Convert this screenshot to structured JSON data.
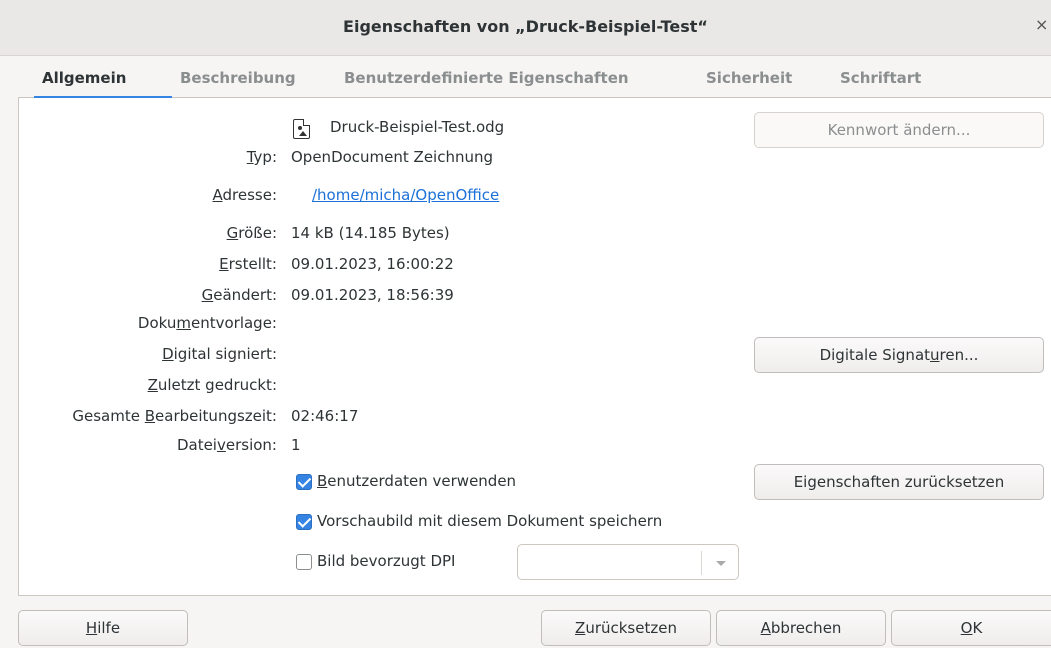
{
  "window": {
    "title": "Eigenschaften von „Druck-Beispiel-Test“",
    "close_label": "×"
  },
  "tabs": [
    {
      "label": "Allgemein",
      "active": true
    },
    {
      "label": "Beschreibung",
      "active": false
    },
    {
      "label": "Benutzerdefinierte Eigenschaften",
      "active": false
    },
    {
      "label": "Sicherheit",
      "active": false
    },
    {
      "label": "Schriftart",
      "active": false
    }
  ],
  "general": {
    "file_name": "Druck-Beispiel-Test.odg",
    "icon": "image-file-icon",
    "type": {
      "label_pre": "",
      "label_u": "T",
      "label_post": "yp:",
      "value": "OpenDocument Zeichnung"
    },
    "address": {
      "label_pre": "",
      "label_u": "A",
      "label_post": "dresse:",
      "value": "/home/micha/OpenOffice"
    },
    "size": {
      "label_pre": "",
      "label_u": "G",
      "label_post": "röße:",
      "value": "14 kB (14.185 Bytes)"
    },
    "created": {
      "label_pre": "",
      "label_u": "E",
      "label_post": "rstellt:",
      "value": "09.01.2023, 16:00:22"
    },
    "modified": {
      "label_pre": "",
      "label_u": "G",
      "label_post": "eändert:",
      "value": "09.01.2023, 18:56:39"
    },
    "template": {
      "label_pre": "Doku",
      "label_u": "m",
      "label_post": "entvorlage:",
      "value": ""
    },
    "signed": {
      "label_pre": "",
      "label_u": "D",
      "label_post": "igital signiert:",
      "value": ""
    },
    "printed": {
      "label_pre": "",
      "label_u": "Z",
      "label_post": "uletzt gedruckt:",
      "value": ""
    },
    "edit_time": {
      "label_pre": "Gesamte ",
      "label_u": "B",
      "label_post": "earbeitungszeit:",
      "value": "02:46:17"
    },
    "version": {
      "label_pre": "Datei",
      "label_u": "v",
      "label_post": "ersion:",
      "value": "1"
    }
  },
  "buttons": {
    "change_password": "Kennwort ändern...",
    "signatures_pre": "Digitale Signat",
    "signatures_u": "u",
    "signatures_post": "ren...",
    "reset_properties": "Eigenschaften zurücksetzen"
  },
  "options": {
    "use_user_data": {
      "u": "B",
      "rest": "enutzerdaten verwenden",
      "checked": true
    },
    "save_thumbnail": {
      "u": "",
      "rest": "Vorschaubild mit diesem Dokument speichern",
      "checked": true
    },
    "preferred_dpi": {
      "u": "",
      "rest": "Bild bevorzugt DPI",
      "checked": false
    },
    "dpi_value": ""
  },
  "footer": {
    "help_u": "H",
    "help_rest": "ilfe",
    "reset_u": "Z",
    "reset_rest": "urücksetzen",
    "cancel_u": "A",
    "cancel_rest": "bbrechen",
    "ok_u": "O",
    "ok_rest": "K"
  }
}
